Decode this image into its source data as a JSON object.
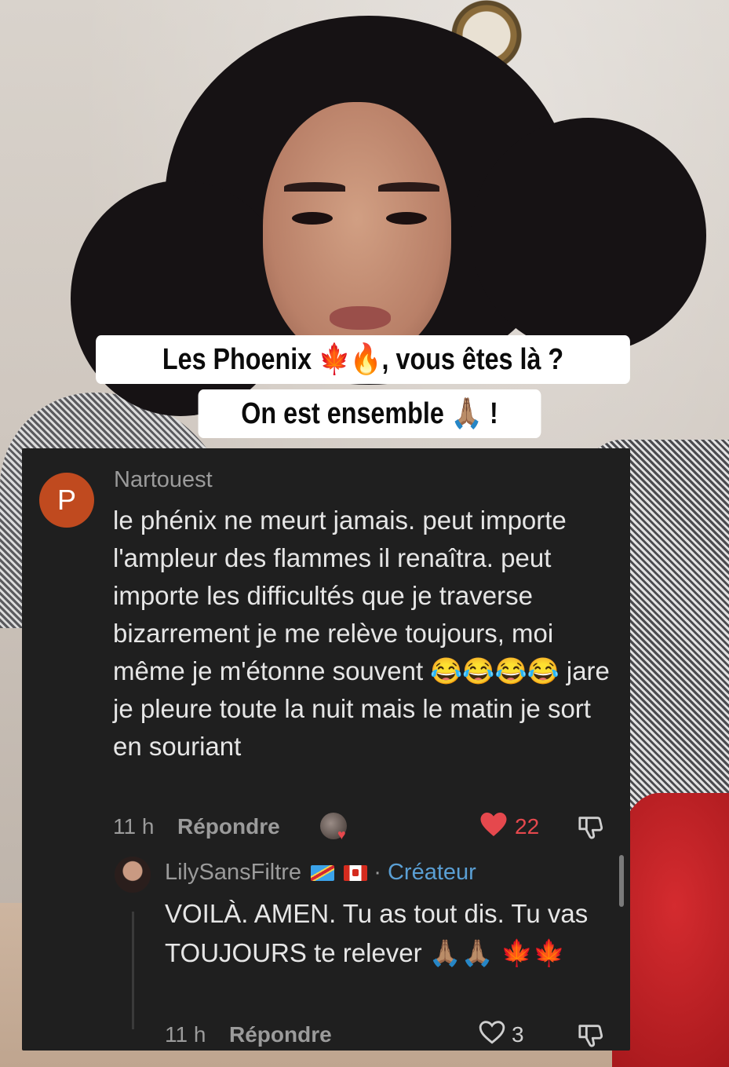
{
  "caption": {
    "line1": "Les Phoenix 🍁🔥, vous êtes là ?",
    "line2": "On est ensemble 🙏🏽 !"
  },
  "comment": {
    "avatar_letter": "P",
    "username": "Nartouest",
    "text": "le phénix ne meurt jamais. peut importe l'ampleur des flammes il renaîtra. peut importe les difficultés que je traverse bizarrement je me relève toujours, moi même je m'étonne souvent 😂😂😂😂 jare je pleure toute la nuit mais le matin je sort en souriant",
    "time": "11 h",
    "reply_label": "Répondre",
    "like_count": "22",
    "liked": true
  },
  "reply": {
    "username": "LilySansFiltre",
    "separator": "·",
    "badge": "Créateur",
    "text": "VOILÀ. AMEN. Tu as tout dis. Tu vas TOUJOURS te relever 🙏🏽🙏🏽 🍁🍁",
    "time": "11 h",
    "reply_label": "Répondre",
    "like_count": "3",
    "liked": false
  },
  "colors": {
    "panel_bg": "#1f1f1f",
    "like_red": "#e5484d",
    "creator_blue": "#5a9fd4",
    "avatar_orange": "#c04a1f"
  },
  "icons": {
    "heart": "heart-icon",
    "dislike": "thumbs-down-icon"
  }
}
